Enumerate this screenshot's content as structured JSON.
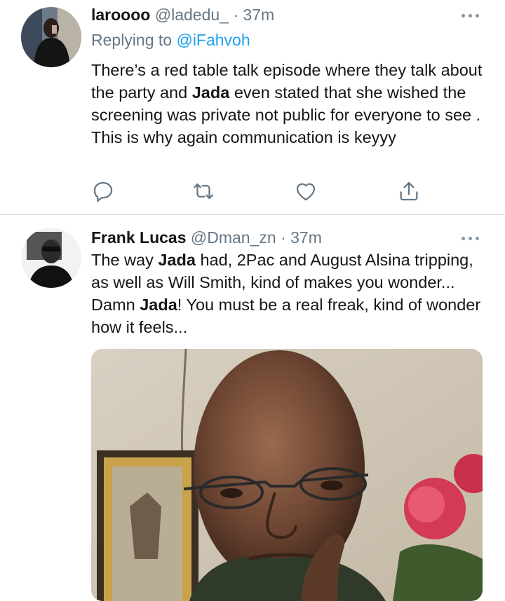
{
  "tweet1": {
    "name": "laroooo",
    "handle": "@ladedu_",
    "separator": "·",
    "time": "37m",
    "reply_prefix": "Replying to",
    "reply_to": "@iFahvoh",
    "text_parts": [
      "There’s a red table talk episode where they talk about the party and ",
      "Jada",
      " even stated that she wished the screening was private not public for everyone to see . This is why again communication is keyyy"
    ],
    "actions": [
      "reply-icon",
      "retweet-icon",
      "like-icon",
      "share-icon"
    ]
  },
  "tweet2": {
    "name": "Frank Lucas",
    "handle": "@Dman_zn",
    "separator": "·",
    "time": "37m",
    "text_parts": [
      "The way ",
      "Jada",
      " had, 2Pac and August Alsina tripping, as well as Will Smith, kind of makes you wonder... Damn ",
      "Jada",
      "! You must be a real freak, kind of wonder how it feels..."
    ],
    "media": "photo"
  },
  "colors": {
    "link": "#1da1f2",
    "secondary_text": "#657786",
    "icon": "#657786",
    "divider": "#d6dce1"
  }
}
